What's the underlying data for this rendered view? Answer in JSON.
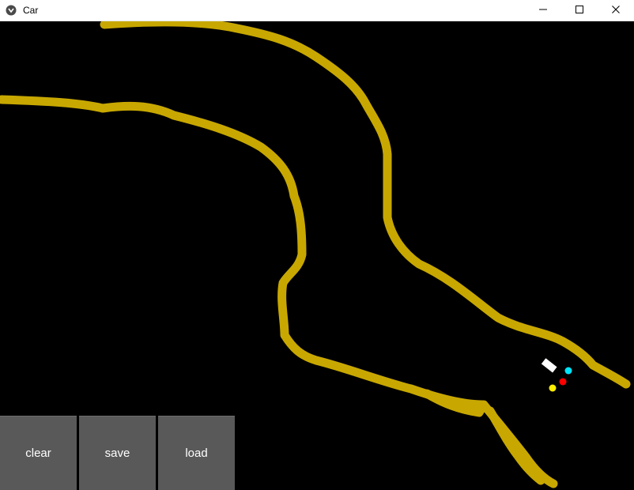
{
  "window": {
    "title": "Car",
    "icon": "kivy-app-icon",
    "controls": [
      "minimize-icon",
      "maximize-icon",
      "close-icon"
    ]
  },
  "simulation": {
    "background_color": "#000000",
    "track_color": "#c8a800",
    "car_color": "#ffffff",
    "sensor_colors": {
      "sensor1": "#00e5ff",
      "sensor2": "#ff0000",
      "sensor3": "#ffee00"
    }
  },
  "toolbar": {
    "clear_label": "clear",
    "save_label": "save",
    "load_label": "load",
    "button_color": "#595959"
  }
}
